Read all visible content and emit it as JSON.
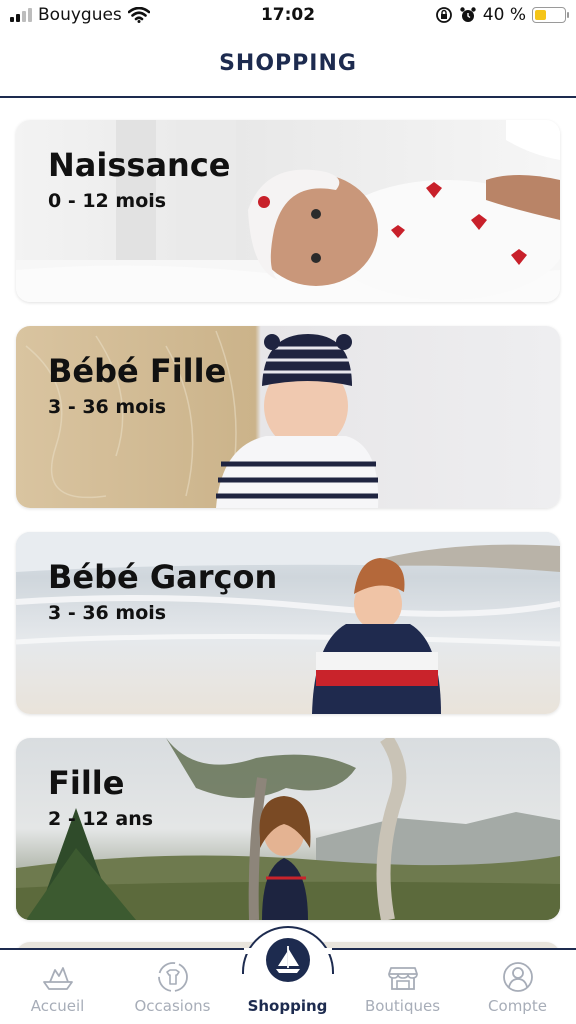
{
  "status_bar": {
    "carrier": "Bouygues",
    "time": "17:02",
    "battery_percent_text": "40 %",
    "battery_level": 0.4,
    "icons": [
      "signal-icon",
      "wifi-icon",
      "rotation-lock-icon",
      "alarm-icon",
      "battery-icon"
    ]
  },
  "header": {
    "title": "SHOPPING"
  },
  "categories": [
    {
      "title": "Naissance",
      "subtitle": "0 - 12 mois"
    },
    {
      "title": "Bébé Fille",
      "subtitle": "3 - 36 mois"
    },
    {
      "title": "Bébé Garçon",
      "subtitle": "3 - 36 mois"
    },
    {
      "title": "Fille",
      "subtitle": "2 - 12 ans"
    }
  ],
  "tabbar": {
    "tabs": [
      {
        "label": "Accueil",
        "icon": "boat-paper-icon"
      },
      {
        "label": "Occasions",
        "icon": "recycle-shirt-icon"
      },
      {
        "label": "Shopping",
        "icon": "sailboat-icon",
        "active": true
      },
      {
        "label": "Boutiques",
        "icon": "storefront-icon"
      },
      {
        "label": "Compte",
        "icon": "user-icon"
      }
    ]
  },
  "colors": {
    "navy": "#1d2b4f",
    "inactive": "#a7adb8",
    "battery": "#f5c518"
  }
}
